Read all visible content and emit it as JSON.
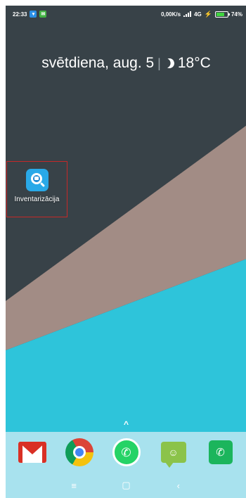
{
  "status_bar": {
    "time": "22:33",
    "network_speed": "0,00K/s",
    "network_type": "4G",
    "battery_percent": "74%",
    "battery_level": 0.74,
    "icons": [
      "notification-app-icon",
      "notification-sms-icon",
      "signal-icon",
      "battery-icon"
    ]
  },
  "widget": {
    "date": "svētdiena, aug. 5",
    "separator": "|",
    "temperature": "18°C",
    "weather_icon": "moon-icon"
  },
  "home_apps": [
    {
      "label": "Inventarizācija",
      "icon": "inventory-app-icon"
    }
  ],
  "dock": {
    "apps": [
      "gmail-icon",
      "chrome-icon",
      "whatsapp-icon",
      "messages-icon",
      "phone-icon"
    ],
    "chevron": "^"
  },
  "nav_bar": {
    "menu": "≡",
    "home": "▢",
    "back": "‹"
  },
  "colors": {
    "wallpaper_dark": "#384248",
    "wallpaper_taupe": "#a28c85",
    "wallpaper_cyan": "#2ec4da",
    "dock_bg": "#a8e2ee",
    "highlight_border": "#c62828"
  }
}
